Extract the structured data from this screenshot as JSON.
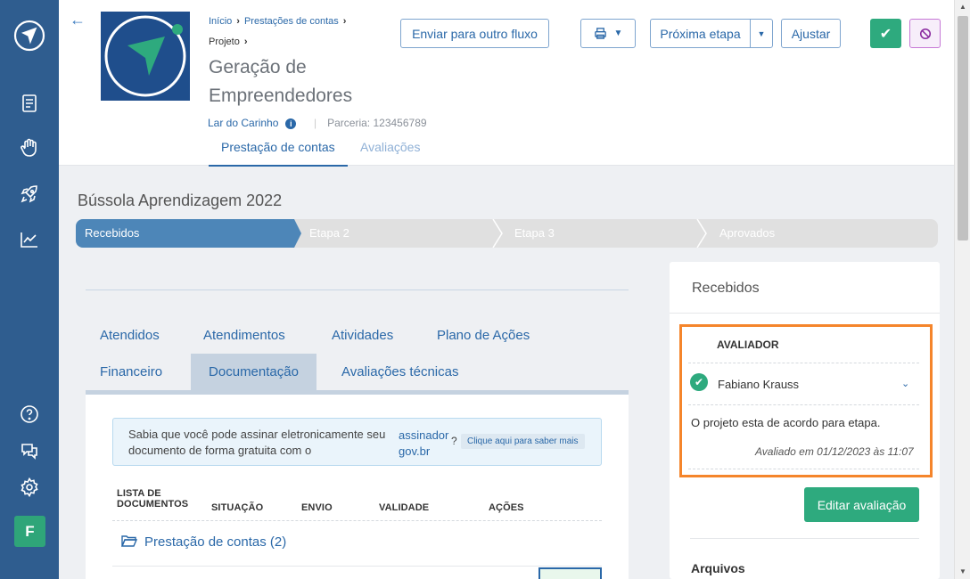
{
  "sidebar": {
    "icons": [
      "navigation-logo-icon",
      "document-icon",
      "hand-heart-icon",
      "rocket-icon",
      "chart-line-icon",
      "help-icon",
      "chat-icon",
      "settings-icon"
    ],
    "avatar_letter": "F"
  },
  "header": {
    "breadcrumb": [
      "Início",
      "Prestações de contas",
      "Projeto"
    ],
    "title": "Geração de Empreendedores",
    "organization": "Lar do Carinho",
    "partnership": "Parceria: 123456789",
    "tabs": [
      "Prestação de contas",
      "Avaliações"
    ],
    "buttons": {
      "send_flow": "Enviar para outro fluxo",
      "next_step": "Próxima etapa",
      "adjust": "Ajustar"
    }
  },
  "main": {
    "section_title": "Bússola Aprendizagem 2022",
    "steps": [
      "Recebidos",
      "Etapa 2",
      "Etapa 3",
      "Aprovados"
    ],
    "content_tabs": [
      "Atendidos",
      "Atendimentos",
      "Atividades",
      "Plano de Ações",
      "Financeiro",
      "Documentação",
      "Avaliações técnicas"
    ],
    "alert": {
      "line1": "Sabia que você pode assinar eletronicamente seu",
      "line2": "documento de forma gratuita com o",
      "link1": "assinador",
      "link2": "gov.br",
      "question_mark": "?",
      "more": "Clique aqui para saber mais"
    },
    "table_headers": {
      "list_l1": "LISTA DE",
      "list_l2": "DOCUMENTOS",
      "status": "SITUAÇÃO",
      "send": "ENVIO",
      "validity": "VALIDADE",
      "actions": "AÇÕES"
    },
    "folder_label": "Prestação de contas (2)"
  },
  "side": {
    "title": "Recebidos",
    "evaluator_header": "AVALIADOR",
    "evaluator_name": "Fabiano Krauss",
    "evaluation_text": "O projeto esta de acordo para etapa.",
    "evaluated_at": "Avaliado em 01/12/2023 às 11:07",
    "edit_button": "Editar avaliação",
    "files_title": "Arquivos"
  },
  "colors": {
    "sidebar": "#2f5d8f",
    "accent": "#2a68a8",
    "success": "#2eaa7e",
    "highlight": "#f5852b"
  }
}
